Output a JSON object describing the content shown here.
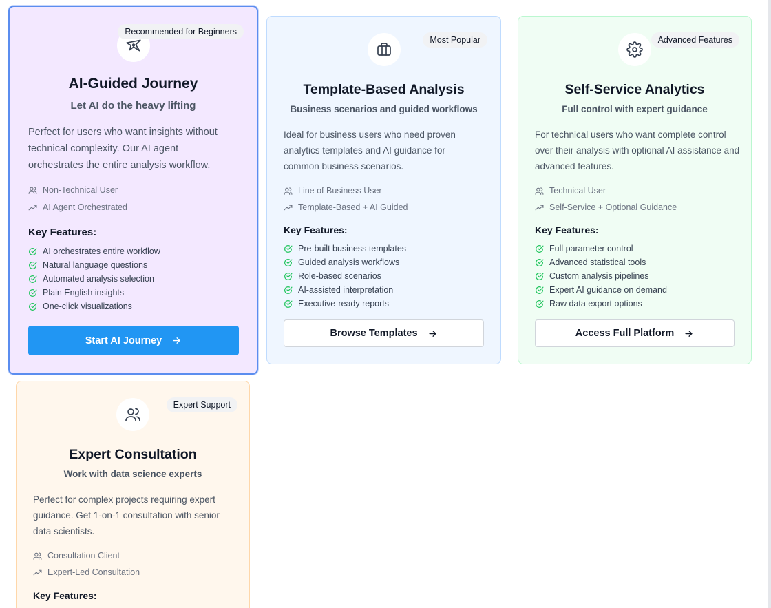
{
  "cards": [
    {
      "badge": "Recommended for Beginners",
      "icon": "sparkle-plane-icon",
      "title": "AI-Guided Journey",
      "subtitle": "Let AI do the heavy lifting",
      "description": "Perfect for users who want insights without technical complexity. Our AI agent orchestrates the entire analysis workflow.",
      "user_type": "Non-Technical User",
      "approach": "AI Agent Orchestrated",
      "features_title": "Key Features:",
      "features": [
        "AI orchestrates entire workflow",
        "Natural language questions",
        "Automated analysis selection",
        "Plain English insights",
        "One-click visualizations"
      ],
      "cta": "Start AI Journey",
      "selected": true,
      "accent": "#f3e8ff"
    },
    {
      "badge": "Most Popular",
      "icon": "briefcase-icon",
      "title": "Template-Based Analysis",
      "subtitle": "Business scenarios and guided workflows",
      "description": "Ideal for business users who need proven analytics templates and AI guidance for common business scenarios.",
      "user_type": "Line of Business User",
      "approach": "Template-Based + AI Guided",
      "features_title": "Key Features:",
      "features": [
        "Pre-built business templates",
        "Guided analysis workflows",
        "Role-based scenarios",
        "AI-assisted interpretation",
        "Executive-ready reports"
      ],
      "cta": "Browse Templates",
      "accent": "#eff6ff"
    },
    {
      "badge": "Advanced Features",
      "icon": "gear-icon",
      "title": "Self-Service Analytics",
      "subtitle": "Full control with expert guidance",
      "description": "For technical users who want complete control over their analysis with optional AI assistance and advanced features.",
      "user_type": "Technical User",
      "approach": "Self-Service + Optional Guidance",
      "features_title": "Key Features:",
      "features": [
        "Full parameter control",
        "Advanced statistical tools",
        "Custom analysis pipelines",
        "Expert AI guidance on demand",
        "Raw data export options"
      ],
      "cta": "Access Full Platform",
      "accent": "#f0fdf4"
    },
    {
      "badge": "Expert Support",
      "icon": "users-icon",
      "title": "Expert Consultation",
      "subtitle": "Work with data science experts",
      "description": "Perfect for complex projects requiring expert guidance. Get 1-on-1 consultation with senior data scientists.",
      "user_type": "Consultation Client",
      "approach": "Expert-Led Consultation",
      "features_title": "Key Features:",
      "accent": "#fff7ed"
    }
  ],
  "colors": {
    "primary_button": "#2196f3",
    "check": "#22c55e",
    "selected_border": "#5b8def"
  }
}
